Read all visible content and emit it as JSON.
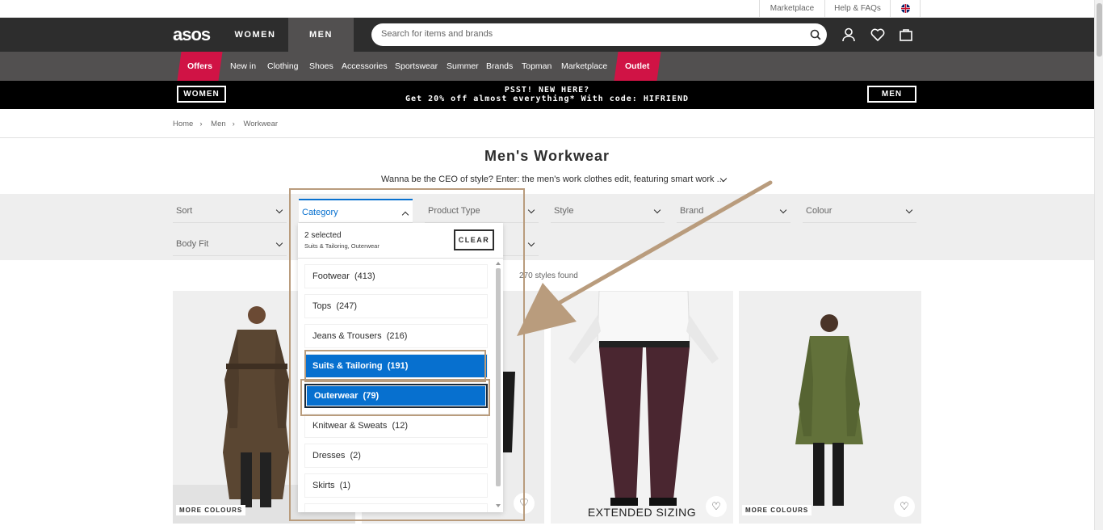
{
  "utility": {
    "marketplace": "Marketplace",
    "help": "Help & FAQs"
  },
  "header": {
    "logo": "asos",
    "tab_women": "WOMEN",
    "tab_men": "MEN",
    "search_placeholder": "Search for items and brands"
  },
  "nav": {
    "items": [
      "Offers",
      "New in",
      "Clothing",
      "Shoes",
      "Accessories",
      "Sportswear",
      "Summer",
      "Brands",
      "Topman",
      "Marketplace",
      "Outlet"
    ]
  },
  "promo": {
    "women_button": "WOMEN",
    "men_button": "MEN",
    "line1": "PSST! NEW HERE?",
    "line2": "Get 20% off almost everything* With code: HIFRIEND"
  },
  "breadcrumb": [
    "Home",
    "Men",
    "Workwear"
  ],
  "page": {
    "title": "Men's Workwear",
    "subtitle": "Wanna be the CEO of style? Enter: the men's work clothes edit, featuring smart work ...",
    "styles_found": "270 styles found"
  },
  "filters": {
    "sort": "Sort",
    "category": "Category",
    "product_type": "Product Type",
    "style": "Style",
    "brand": "Brand",
    "colour": "Colour",
    "body_fit": "Body Fit"
  },
  "category_dropdown": {
    "selected_count": "2 selected",
    "selected_items": "Suits & Tailoring, Outerwear",
    "clear": "CLEAR",
    "options": [
      {
        "name": "Footwear",
        "count": "(413)",
        "selected": false
      },
      {
        "name": "Tops",
        "count": "(247)",
        "selected": false
      },
      {
        "name": "Jeans & Trousers",
        "count": "(216)",
        "selected": false
      },
      {
        "name": "Suits & Tailoring",
        "count": "(191)",
        "selected": true
      },
      {
        "name": "Outerwear",
        "count": "(79)",
        "selected": true
      },
      {
        "name": "Knitwear & Sweats",
        "count": "(12)",
        "selected": false
      },
      {
        "name": "Dresses",
        "count": "(2)",
        "selected": false
      },
      {
        "name": "Skirts",
        "count": "(1)",
        "selected": false
      }
    ]
  },
  "products": {
    "more_colours": "MORE COLOURS",
    "extended_sizing": "EXTENDED SIZING"
  },
  "colors": {
    "accent_blue": "#0770cf",
    "sale_red": "#d01345",
    "annotation": "#b99c7d"
  }
}
